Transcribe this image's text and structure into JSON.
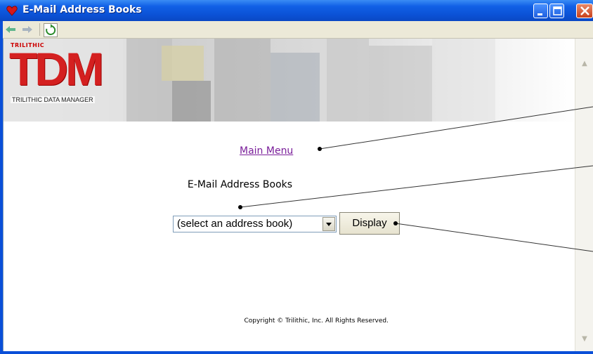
{
  "window": {
    "title": "E-Mail Address Books",
    "title_icon": "heart-icon",
    "controls": [
      "minimize-icon",
      "maximize-icon",
      "close-icon"
    ]
  },
  "toolbar": {
    "icons": [
      "back-arrow-icon",
      "forward-arrow-icon",
      "refresh-icon"
    ]
  },
  "banner": {
    "brand_small": "TRILITHIC",
    "logo": "TDM",
    "logo_subtitle": "TRILITHIC DATA MANAGER"
  },
  "page": {
    "main_menu_link": "Main Menu",
    "heading": "E-Mail Address Books",
    "select_value": "(select an address book)",
    "display_button": "Display",
    "copyright": "Copyright © Trilithic, Inc. All Rights Reserved."
  },
  "colors": {
    "title_bar": "#0a4fd8",
    "logo_red": "#d42020",
    "link_visited": "#7a1e9a"
  }
}
